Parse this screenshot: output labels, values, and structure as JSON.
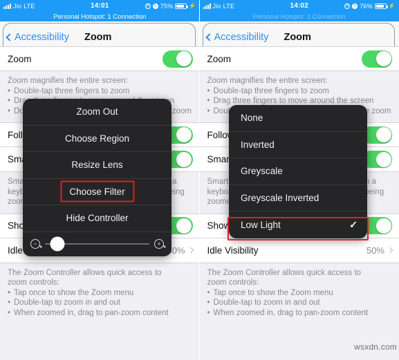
{
  "panels": [
    {
      "statusbar": {
        "carrier": "Jio",
        "network": "LTE",
        "time": "14:01",
        "battery_percent": "75%",
        "alarm_icon": "alarm-clock-icon",
        "rotation_lock_icon": "rotation-lock-icon",
        "battery_icon": "battery-icon",
        "charging_icon": "lightning-bolt-icon"
      },
      "hotspot": "Personal Hotspot: 1 Connection",
      "nav": {
        "back_label": "Accessibility",
        "title": "Zoom"
      },
      "rows": {
        "zoom_label": "Zoom",
        "follow_focus_label": "Follow Focus",
        "smart_typing_label": "Smart Typing",
        "show_controller_label": "Show Controller",
        "idle_visibility_label": "Idle Visibility",
        "idle_visibility_value": "50%"
      },
      "zoom_desc": {
        "head": "Zoom magnifies the entire screen:",
        "bullets": [
          "Double-tap three fingers to zoom",
          "Drag three fingers to move around the screen",
          "Double-tap three fingers and drag to change zoom"
        ]
      },
      "smart_desc": [
        "Smart Typing switches to Window Zoom when a",
        "keyboard appears on the screen, so the text being",
        "zoomed is visible above the keyboard."
      ],
      "footer": {
        "head1": "The Zoom Controller allows quick access to",
        "head2": "zoom controls:",
        "bullets": [
          "Tap once to show the Zoom menu",
          "Double-tap to zoom in and out",
          "When zoomed in, drag to pan-zoom content"
        ]
      },
      "popup": {
        "items": [
          {
            "label": "Zoom Out",
            "selected": false
          },
          {
            "label": "Choose Region",
            "selected": false
          },
          {
            "label": "Resize Lens",
            "selected": false
          },
          {
            "label": "Choose Filter",
            "selected": true
          },
          {
            "label": "Hide Controller",
            "selected": false
          }
        ],
        "slider": {
          "minus_icon": "zoom-out-magnifier-icon",
          "plus_icon": "zoom-in-magnifier-icon",
          "minus_glyph": "−",
          "plus_glyph": "+",
          "value_percent": 12
        }
      }
    },
    {
      "statusbar": {
        "carrier": "Jio",
        "network": "LTE",
        "time": "14:02",
        "battery_percent": "76%",
        "alarm_icon": "alarm-clock-icon",
        "rotation_lock_icon": "rotation-lock-icon",
        "battery_icon": "battery-icon",
        "charging_icon": "lightning-bolt-icon"
      },
      "hotspot": "Personal Hotspot: 1 Connection",
      "nav": {
        "back_label": "Accessibility",
        "title": "Zoom"
      },
      "rows": {
        "zoom_label": "Zoom",
        "follow_focus_label": "Follow Focus",
        "smart_typing_label": "Smart Typing",
        "show_controller_label": "Show Controller",
        "idle_visibility_label": "Idle Visibility",
        "idle_visibility_value": "50%"
      },
      "zoom_desc": {
        "head": "Zoom magnifies the entire screen:",
        "bullets": [
          "Double-tap three fingers to zoom",
          "Drag three fingers to move around the screen",
          "Double-tap three fingers and drag to change zoom"
        ]
      },
      "smart_desc": [
        "Smart Typing switches to Window Zoom when a",
        "keyboard appears on the screen, so the text being",
        "zoomed is visible above the keyboard."
      ],
      "footer": {
        "head1": "The Zoom Controller allows quick access to",
        "head2": "zoom controls:",
        "bullets": [
          "Tap once to show the Zoom menu",
          "Double-tap to zoom in and out",
          "When zoomed in, drag to pan-zoom content"
        ]
      },
      "popup": {
        "items": [
          {
            "label": "None",
            "selected": false,
            "checked": false
          },
          {
            "label": "Inverted",
            "selected": false,
            "checked": false
          },
          {
            "label": "Greyscale",
            "selected": false,
            "checked": false
          },
          {
            "label": "Greyscale Inverted",
            "selected": false,
            "checked": false
          },
          {
            "label": "Low Light",
            "selected": true,
            "checked": true
          }
        ],
        "check_glyph": "✓"
      }
    }
  ],
  "watermark": "wsxdn.com",
  "colors": {
    "status_bar": "#1d9bf6",
    "toggle_on": "#4cd764",
    "tint_blue": "#2d8cf0",
    "highlight_red": "#e02020",
    "popup_bg": "#252527",
    "page_bg": "#efeff4"
  }
}
